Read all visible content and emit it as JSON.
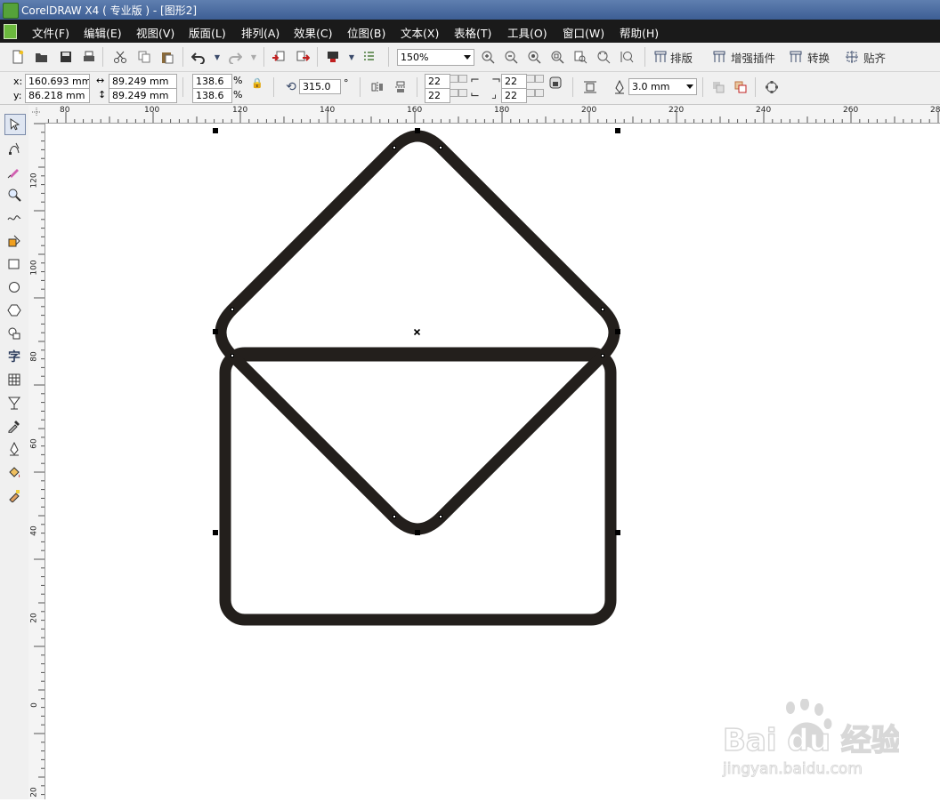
{
  "window": {
    "title": "CorelDRAW X4 ( 专业版 ) - [图形2]"
  },
  "menu": [
    {
      "label": "文件(F)"
    },
    {
      "label": "编辑(E)"
    },
    {
      "label": "视图(V)"
    },
    {
      "label": "版面(L)"
    },
    {
      "label": "排列(A)"
    },
    {
      "label": "效果(C)"
    },
    {
      "label": "位图(B)"
    },
    {
      "label": "文本(X)"
    },
    {
      "label": "表格(T)"
    },
    {
      "label": "工具(O)"
    },
    {
      "label": "窗口(W)"
    },
    {
      "label": "帮助(H)"
    }
  ],
  "standard_toolbar": {
    "zoom_value": "150%",
    "plugin_buttons": [
      {
        "label": "排版",
        "icon": "layout-icon"
      },
      {
        "label": "增强插件",
        "icon": "plugin-icon"
      },
      {
        "label": "转换",
        "icon": "convert-icon"
      },
      {
        "label": "贴齐",
        "icon": "snap-icon"
      }
    ]
  },
  "property_bar": {
    "x_label": "x:",
    "x_value": "160.693 mm",
    "y_label": "y:",
    "y_value": "86.218 mm",
    "width_value": "89.249 mm",
    "height_value": "89.249 mm",
    "scale_x": "138.6",
    "scale_y": "138.6",
    "percent": "%",
    "rotation": "315.0",
    "degree": "°",
    "corner_tl": "22",
    "corner_bl": "22",
    "corner_tr": "22",
    "corner_br": "22",
    "outline_width": "3.0 mm"
  },
  "ruler": {
    "top_ticks": [
      "80",
      "100",
      "120",
      "140",
      "160",
      "180",
      "200",
      "220",
      "240",
      "260",
      "280"
    ],
    "left_ticks": [
      "120",
      "100",
      "80",
      "60",
      "40",
      "20",
      "0",
      "20"
    ]
  },
  "drawing": {
    "stroke_color": "#231f1c",
    "description_icon": "envelope-shape"
  },
  "watermark": {
    "brand": "Bai du 经验",
    "url": "jingyan.baidu.com"
  }
}
